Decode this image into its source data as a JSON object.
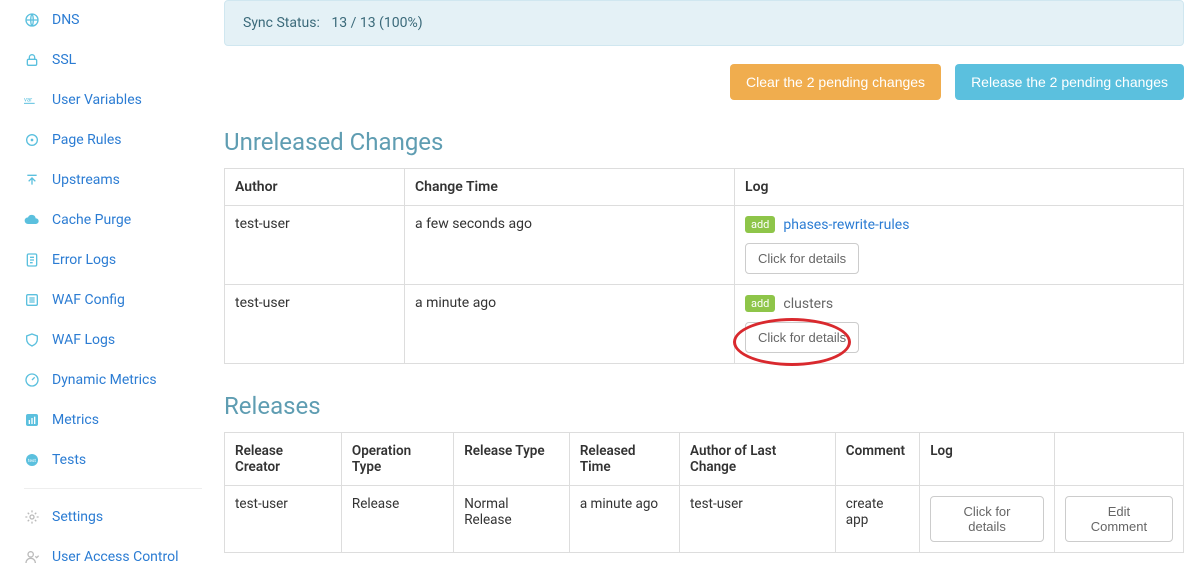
{
  "sidebar": {
    "items": [
      {
        "label": "DNS",
        "icon": "globe-icon"
      },
      {
        "label": "SSL",
        "icon": "lock-icon"
      },
      {
        "label": "User Variables",
        "icon": "var-icon"
      },
      {
        "label": "Page Rules",
        "icon": "target-icon"
      },
      {
        "label": "Upstreams",
        "icon": "upstream-icon"
      },
      {
        "label": "Cache Purge",
        "icon": "cloud-icon"
      },
      {
        "label": "Error Logs",
        "icon": "doc-icon"
      },
      {
        "label": "WAF Config",
        "icon": "list-icon"
      },
      {
        "label": "WAF Logs",
        "icon": "shield-icon"
      },
      {
        "label": "Dynamic Metrics",
        "icon": "gauge-icon"
      },
      {
        "label": "Metrics",
        "icon": "chart-icon"
      },
      {
        "label": "Tests",
        "icon": "test-icon"
      }
    ],
    "footer": [
      {
        "label": "Settings",
        "icon": "gear-icon"
      },
      {
        "label": "User Access Control",
        "icon": "user-icon"
      }
    ]
  },
  "sync": {
    "label": "Sync Status:",
    "value": "13 / 13 (100%)"
  },
  "buttons": {
    "clear": "Clear the 2 pending changes",
    "release": "Release the 2 pending changes"
  },
  "unreleased": {
    "title": "Unreleased Changes",
    "headers": {
      "author": "Author",
      "time": "Change Time",
      "log": "Log"
    },
    "rows": [
      {
        "author": "test-user",
        "time": "a few seconds ago",
        "tag": "add",
        "log": "phases-rewrite-rules",
        "detail": "Click for details"
      },
      {
        "author": "test-user",
        "time": "a minute ago",
        "tag": "add",
        "log": "clusters",
        "detail": "Click for details"
      }
    ]
  },
  "releases": {
    "title": "Releases",
    "headers": {
      "creator": "Release Creator",
      "optype": "Operation Type",
      "reltype": "Release Type",
      "reltime": "Released Time",
      "lastauth": "Author of Last Change",
      "comment": "Comment",
      "log": "Log"
    },
    "rows": [
      {
        "creator": "test-user",
        "optype": "Release",
        "reltype": "Normal Release",
        "reltime": "a minute ago",
        "lastauth": "test-user",
        "comment": "create app",
        "log_btn": "Click for details",
        "edit_btn": "Edit Comment"
      }
    ]
  }
}
